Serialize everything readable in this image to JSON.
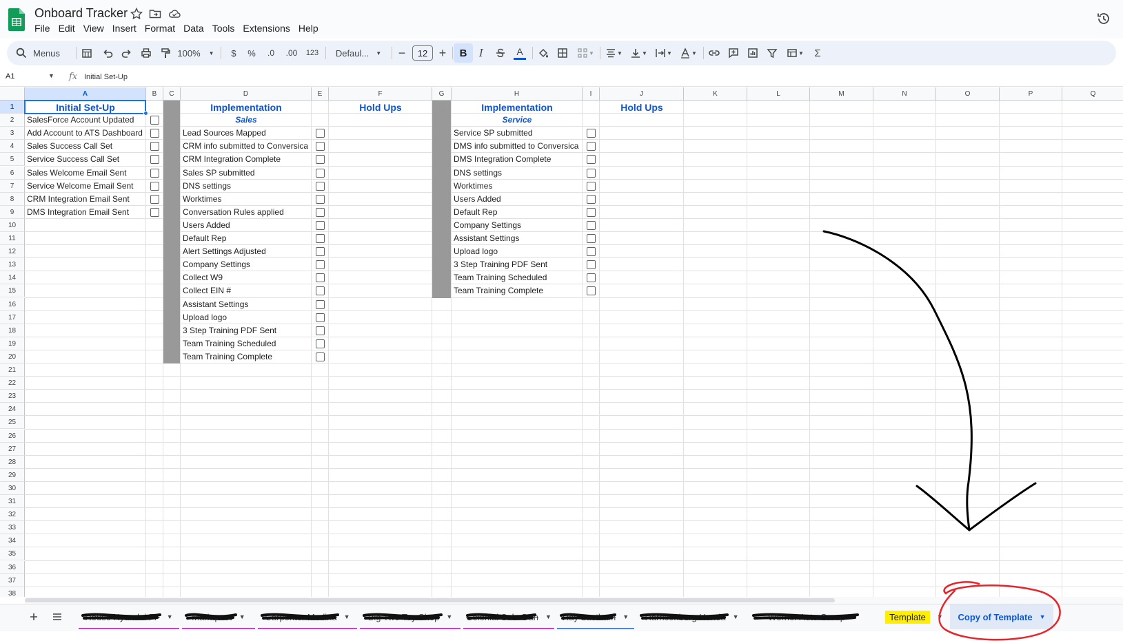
{
  "app": {
    "doc_title": "Onboard Tracker",
    "menu": [
      "File",
      "Edit",
      "View",
      "Insert",
      "Format",
      "Data",
      "Tools",
      "Extensions",
      "Help"
    ]
  },
  "toolbar": {
    "search_label": "Menus",
    "zoom": "100%",
    "currency": "$",
    "percent": "%",
    "dec_decrease": ".0",
    "dec_increase": ".00",
    "number_format": "123",
    "font": "Defaul...",
    "font_size": "12",
    "bold": "B",
    "italic": "I",
    "text_color": "A"
  },
  "formula_bar": {
    "name_box": "A1",
    "fx": "fx",
    "value": "Initial Set-Up"
  },
  "columns": [
    "A",
    "B",
    "C",
    "D",
    "E",
    "F",
    "G",
    "H",
    "I",
    "J",
    "K",
    "L",
    "M",
    "N",
    "O",
    "P",
    "Q"
  ],
  "rows": [
    "1",
    "2",
    "3",
    "4",
    "5",
    "6",
    "7",
    "8",
    "9",
    "10",
    "11",
    "12",
    "13",
    "14",
    "15",
    "16",
    "17",
    "18",
    "19",
    "20",
    "21",
    "22",
    "23",
    "24",
    "25",
    "26",
    "27",
    "28",
    "29",
    "30",
    "31",
    "32",
    "33",
    "34",
    "35",
    "36",
    "37",
    "38"
  ],
  "sheet": {
    "initial_setup": {
      "header": "Initial Set-Up",
      "items": [
        "SalesForce Account Updated",
        "Add Account to ATS Dashboard",
        "Sales Success Call Set",
        "Service Success Call Set",
        "Sales Welcome Email Sent",
        "Service Welcome Email Sent",
        "CRM Integration Email Sent",
        "DMS Integration Email Sent"
      ]
    },
    "sales": {
      "header": "Implementation",
      "subheader": "Sales",
      "hold_ups": "Hold Ups",
      "items": [
        "Lead Sources Mapped",
        "CRM info submitted to Conversica",
        "CRM Integration Complete",
        "Sales SP submitted",
        "DNS settings",
        "Worktimes",
        "Conversation Rules applied",
        "Users Added",
        "Default Rep",
        "Alert Settings Adjusted",
        "Company Settings",
        "Collect W9",
        "Collect EIN #",
        "Assistant Settings",
        "Upload logo",
        "3 Step Training PDF Sent",
        "Team Training Scheduled",
        "Team Training Complete"
      ]
    },
    "service": {
      "header": "Implementation",
      "subheader": "Service",
      "hold_ups": "Hold Ups",
      "items": [
        "Service SP submitted",
        "DMS info submitted to Conversica",
        "DMS Integration Complete",
        "DNS settings",
        "Worktimes",
        "Users Added",
        "Default Rep",
        "Company Settings",
        "Assistant Settings",
        "Upload logo",
        "3 Step Training PDF Sent",
        "Team Training Scheduled",
        "Team Training Complete"
      ]
    }
  },
  "tabs": [
    {
      "label": "Rouse Hyundai FF",
      "redacted": true,
      "underline": "#d63ad6"
    },
    {
      "label": "Markquart",
      "redacted": true,
      "underline": "#d63ad6"
    },
    {
      "label": "Carpenter Medina",
      "redacted": true,
      "underline": "#d63ad6"
    },
    {
      "label": "Big Two Toy Shop",
      "redacted": true,
      "underline": "#d63ad6"
    },
    {
      "label": "Colonial Sub. Dan",
      "redacted": true,
      "underline": "#d63ad6"
    },
    {
      "label": "Ray Laetham",
      "redacted": true,
      "underline": "#4a86e8"
    },
    {
      "label": "Harrisonburg Honda",
      "redacted": true,
      "underline": ""
    },
    {
      "label": "Werner Auto Group",
      "redacted": true,
      "underline": ""
    },
    {
      "label": "Template",
      "redacted": false,
      "highlight": "#ffee00"
    },
    {
      "label": "Copy of Template",
      "redacted": false,
      "active": true
    }
  ],
  "annotation": {
    "arrow_color": "#000000",
    "circle_color": "#e8242a"
  },
  "colors": {
    "accent": "#1a73e8",
    "header_text": "#1155cc",
    "band": "#999999"
  },
  "icons": [
    "sheets-logo",
    "star-icon",
    "move-folder-icon",
    "cloud-icon",
    "history-icon",
    "search-icon",
    "add-sheet-icon",
    "all-sheets-icon"
  ]
}
